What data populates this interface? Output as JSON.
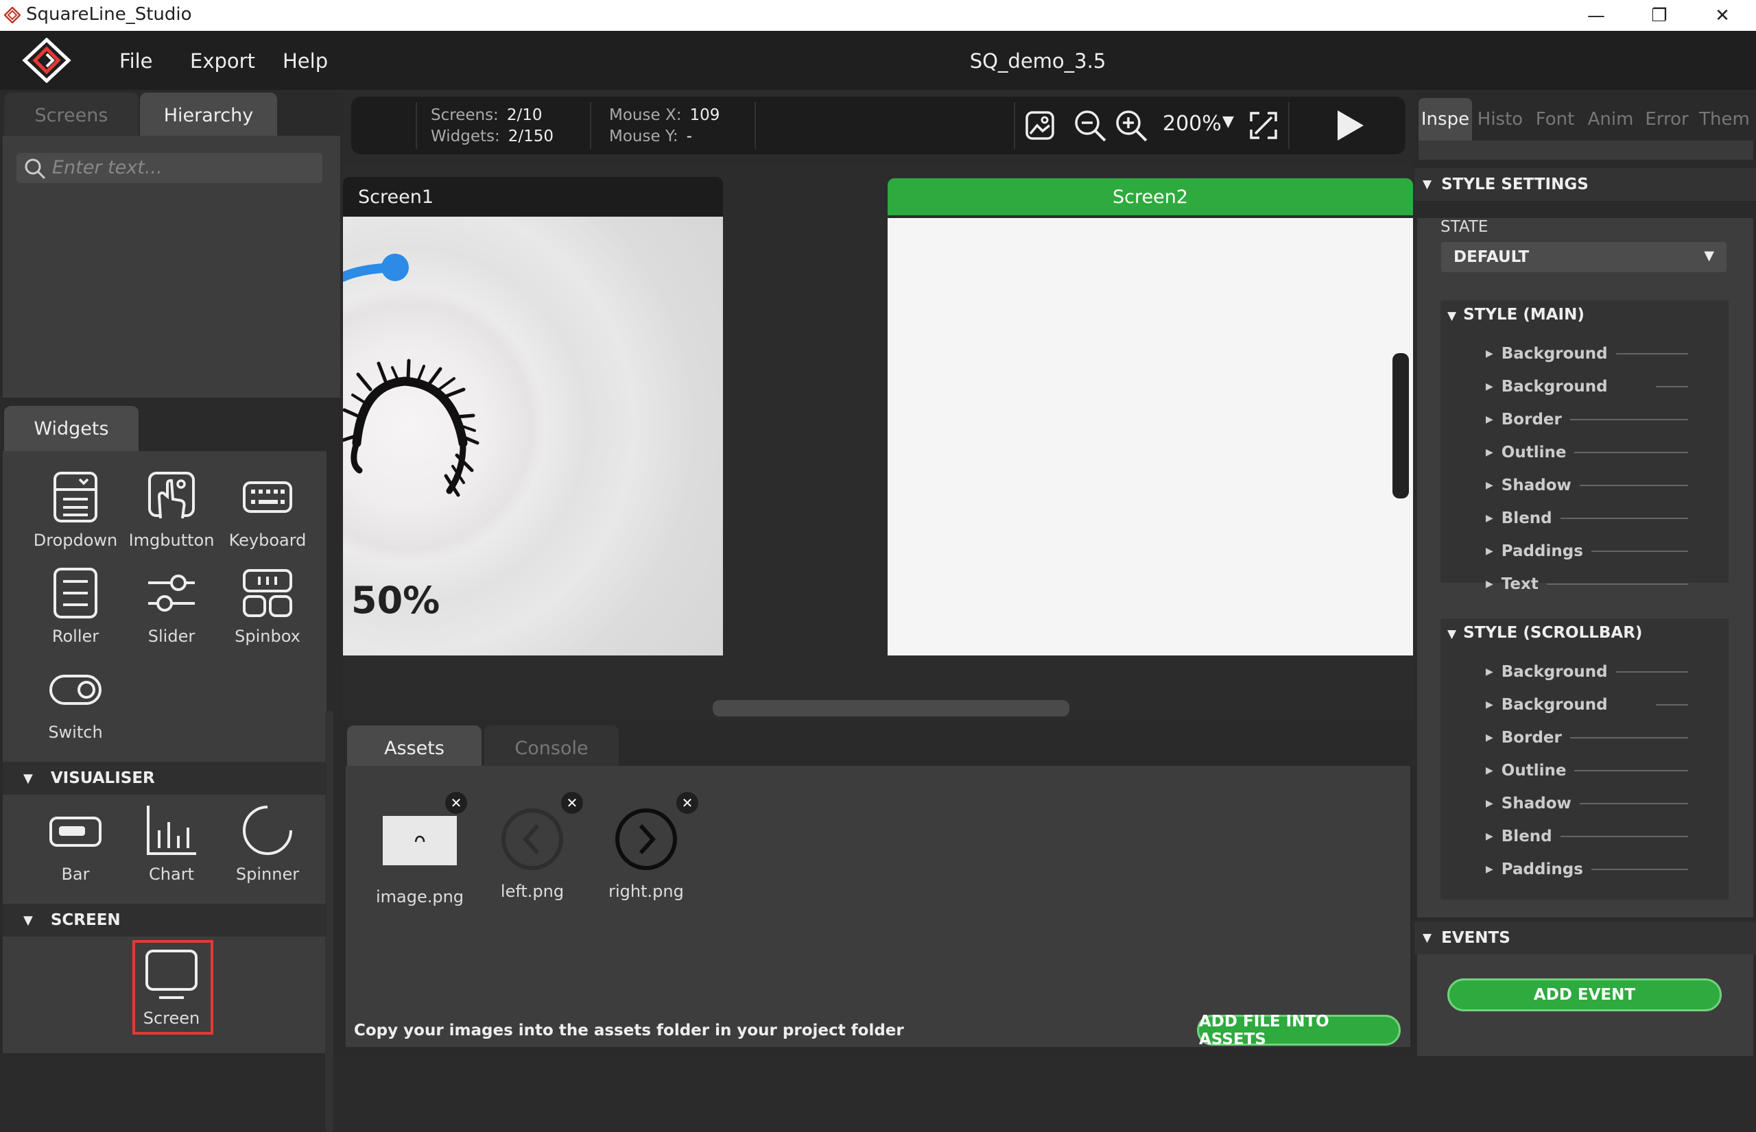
{
  "window": {
    "title": "SquareLine_Studio",
    "minimize": "—",
    "maximize": "❐",
    "close": "✕"
  },
  "menu": {
    "items": [
      "File",
      "Export",
      "Help"
    ],
    "project": "SQ_demo_3.5"
  },
  "left": {
    "tabs": [
      "Screens",
      "Hierarchy"
    ],
    "search_placeholder": "Enter text...",
    "widgets_tab": "Widgets",
    "widgets": [
      "Dropdown",
      "Imgbutton",
      "Keyboard",
      "Roller",
      "Slider",
      "Spinbox",
      "Switch"
    ],
    "visualiser_title": "VISUALISER",
    "visualiser": [
      "Bar",
      "Chart",
      "Spinner"
    ],
    "screen_title": "SCREEN",
    "screen": [
      "Screen"
    ]
  },
  "toolbar": {
    "screens_label": "Screens:",
    "screens_value": "2/10",
    "widgets_label": "Widgets:",
    "widgets_value": "2/150",
    "mousex_label": "Mouse X:",
    "mousex_value": "109",
    "mousey_label": "Mouse Y:",
    "mousey_value": "-",
    "zoom": "200%"
  },
  "screens": {
    "screen1": {
      "title": "Screen1",
      "arc_label": "50%"
    },
    "screen2": {
      "title": "Screen2"
    }
  },
  "assets": {
    "tabs": [
      "Assets",
      "Console"
    ],
    "files": [
      "image.png",
      "left.png",
      "right.png"
    ],
    "hint": "Copy your images into the assets folder in your project folder",
    "add_button": "ADD FILE INTO ASSETS"
  },
  "inspector": {
    "tabs": [
      "Inspe",
      "Histo",
      "Font",
      "Anim",
      "Error",
      "Them"
    ],
    "style_settings": "STYLE SETTINGS",
    "state_label": "STATE",
    "state_value": "DEFAULT",
    "style_main": "STYLE (MAIN)",
    "main_rows": [
      "Background",
      "Background",
      "Border",
      "Outline",
      "Shadow",
      "Blend",
      "Paddings",
      "Text"
    ],
    "style_scrollbar": "STYLE (SCROLLBAR)",
    "scroll_rows": [
      "Background",
      "Background",
      "Border",
      "Outline",
      "Shadow",
      "Blend",
      "Paddings"
    ],
    "events": "EVENTS",
    "add_event": "ADD EVENT"
  },
  "colors": {
    "accent_green": "#2eaa3e",
    "arc_blue": "#2b8be6",
    "highlight_red": "#e53935"
  }
}
